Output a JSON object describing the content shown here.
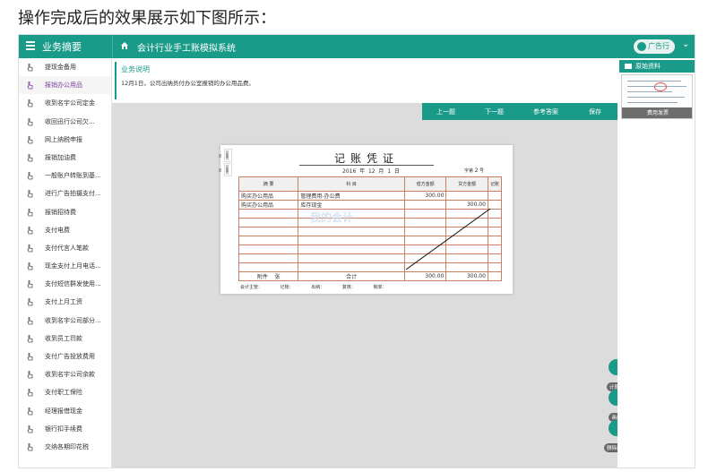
{
  "caption": "操作完成后的效果展示如下图所示：",
  "topbar": {
    "left_title": "业务摘要",
    "app_title": "会计行业手工账模拟系统",
    "industry": "广告行业"
  },
  "sidebar": {
    "items": [
      {
        "label": "提现金备用"
      },
      {
        "label": "报销办公用品"
      },
      {
        "label": "收到名宇公司定金"
      },
      {
        "label": "收回迅行公司欠..."
      },
      {
        "label": "网上纳税申报"
      },
      {
        "label": "报销加油费"
      },
      {
        "label": "一般账户转账到基..."
      },
      {
        "label": "进行广告拍摄支付..."
      },
      {
        "label": "报销招待费"
      },
      {
        "label": "支付电费"
      },
      {
        "label": "支付代言人笔款"
      },
      {
        "label": "现金支付上月电话..."
      },
      {
        "label": "支付短信群发使用..."
      },
      {
        "label": "支付上月工资"
      },
      {
        "label": "收到名宇公司部分..."
      },
      {
        "label": "收到员工罚款"
      },
      {
        "label": "支付广告投放费用"
      },
      {
        "label": "收到名宇公司余款"
      },
      {
        "label": "支付职工保险"
      },
      {
        "label": "经理报借现金"
      },
      {
        "label": "银行扣手续费"
      },
      {
        "label": "交纳各期印花税"
      }
    ]
  },
  "description": {
    "title": "业务说明",
    "text": "12月1日，公司出纳员付办公室报销的办公用品费。"
  },
  "buttons": {
    "prev": "上一题",
    "next": "下一题",
    "answer": "参考答案",
    "save": "保存"
  },
  "voucher": {
    "side_tabs": [
      "记账凭证",
      "记账凭证"
    ],
    "title": "记账凭证",
    "year": "2016",
    "year_unit": "年",
    "month": "12",
    "month_unit": "月",
    "day": "1",
    "day_unit": "日",
    "no_label": "字第",
    "no": "2",
    "no_unit": "号",
    "headers": {
      "summary": "摘 要",
      "account": "科 目",
      "debit": "借方金额",
      "credit": "贷方金额",
      "mark": "记账"
    },
    "rows": [
      {
        "summary": "购买办公用品",
        "account": "管理费用-办公费",
        "debit": "300.00",
        "credit": ""
      },
      {
        "summary": "购买办公用品",
        "account": "库存现金",
        "debit": "",
        "credit": "300.00"
      }
    ],
    "footer_attach": "附件",
    "footer_unit": "张",
    "footer_total": "合计",
    "total_debit": "300.00",
    "total_credit": "300.00",
    "signers": [
      "会计主管：",
      "记账：",
      "出纳：",
      "复核：",
      "制单："
    ],
    "watermark": "我的会计"
  },
  "tools": {
    "calculator": "计算器",
    "draw": "画线",
    "erase": "删除画线"
  },
  "right_panel": {
    "title": "原始资料",
    "thumb_caption": "费用发票"
  },
  "colors": {
    "accent": "#1a9a88",
    "table_border": "#c87f62",
    "active_item": "#7c3f9e"
  }
}
